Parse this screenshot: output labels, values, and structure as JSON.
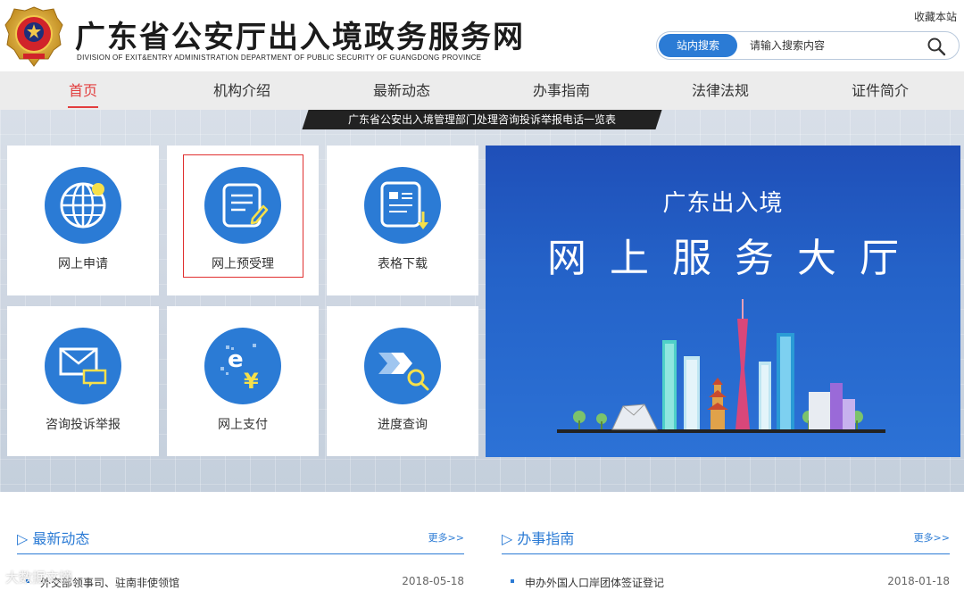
{
  "header": {
    "title_cn": "广东省公安厅出入境政务服务网",
    "title_en": "DIVISION OF EXIT&ENTRY ADMINISTRATION DEPARTMENT OF PUBLIC SECURITY OF GUANGDONG PROVINCE",
    "bookmark": "收藏本站",
    "search_tab": "站内搜索",
    "search_placeholder": "请输入搜索内容"
  },
  "nav": {
    "items": [
      {
        "label": "首页"
      },
      {
        "label": "机构介绍"
      },
      {
        "label": "最新动态"
      },
      {
        "label": "办事指南"
      },
      {
        "label": "法律法规"
      },
      {
        "label": "证件简介"
      }
    ]
  },
  "notice": "广东省公安出入境管理部门处理咨询投诉举报电话一览表",
  "tiles": [
    {
      "label": "网上申请",
      "icon": "globe-icon"
    },
    {
      "label": "网上预受理",
      "icon": "document-edit-icon"
    },
    {
      "label": "表格下载",
      "icon": "form-download-icon"
    },
    {
      "label": "咨询投诉举报",
      "icon": "mail-chat-icon"
    },
    {
      "label": "网上支付",
      "icon": "e-payment-icon"
    },
    {
      "label": "进度查询",
      "icon": "progress-search-icon"
    }
  ],
  "service_banner": {
    "sub": "广东出入境",
    "main": "网上服务大厅"
  },
  "panels": {
    "news": {
      "title": "最新动态",
      "more": "更多>>",
      "items": [
        {
          "title": "外交部领事司、驻南非使领馆",
          "date": "2018-05-18"
        }
      ]
    },
    "guide": {
      "title": "办事指南",
      "more": "更多>>",
      "items": [
        {
          "title": "申办外国人口岸团体签证登记",
          "date": "2018-01-18"
        }
      ]
    }
  },
  "colors": {
    "accent_blue": "#2b7bd5",
    "active_red": "#e23e3e",
    "banner_blue": "#2462c8"
  },
  "watermark": "大数据文摘"
}
